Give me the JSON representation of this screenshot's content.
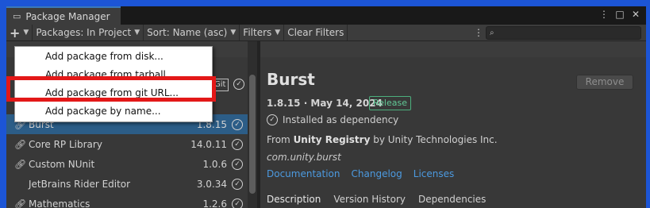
{
  "window": {
    "title": "Package Manager",
    "controls": [
      "⋮",
      "□",
      "✕"
    ]
  },
  "toolbar": {
    "add_icon": "+",
    "packages_label": "Packages: In Project",
    "sort_label": "Sort: Name (asc)",
    "filters_label": "Filters",
    "clear_filters_label": "Clear Filters",
    "search_placeholder": ""
  },
  "add_menu": {
    "items": [
      {
        "label": "Add package from disk..."
      },
      {
        "label": "Add package from tarball..."
      },
      {
        "label": "Add package from git URL..."
      },
      {
        "label": "Add package by name..."
      }
    ],
    "highlighted_index": 2
  },
  "package_list": {
    "git_badge": "Git",
    "rows": [
      {
        "name": "Burst",
        "version": "1.8.15",
        "selected": true,
        "icon": "link-icon"
      },
      {
        "name": "Core RP Library",
        "version": "14.0.11",
        "selected": false,
        "icon": "link-icon"
      },
      {
        "name": "Custom NUnit",
        "version": "1.0.6",
        "selected": false,
        "icon": "link-icon"
      },
      {
        "name": "JetBrains Rider Editor",
        "version": "3.0.34",
        "selected": false,
        "icon": ""
      },
      {
        "name": "Mathematics",
        "version": "1.2.6",
        "selected": false,
        "icon": "link-icon"
      }
    ]
  },
  "details": {
    "title": "Burst",
    "remove_label": "Remove",
    "version_line": "1.8.15 · May 14, 2024",
    "release_badge": "Release",
    "installed_text": "Installed as dependency",
    "from_prefix": "From",
    "registry": "Unity Registry",
    "from_suffix": "by Unity Technologies Inc.",
    "package_id": "com.unity.burst",
    "links": [
      "Documentation",
      "Changelog",
      "Licenses"
    ],
    "tabs": [
      "Description",
      "Version History",
      "Dependencies"
    ],
    "active_tab": 0
  },
  "colors": {
    "selected_row": "#2c5d87",
    "highlight_box": "#e31818",
    "link": "#4c9ae0",
    "release_badge": "#62c896"
  }
}
